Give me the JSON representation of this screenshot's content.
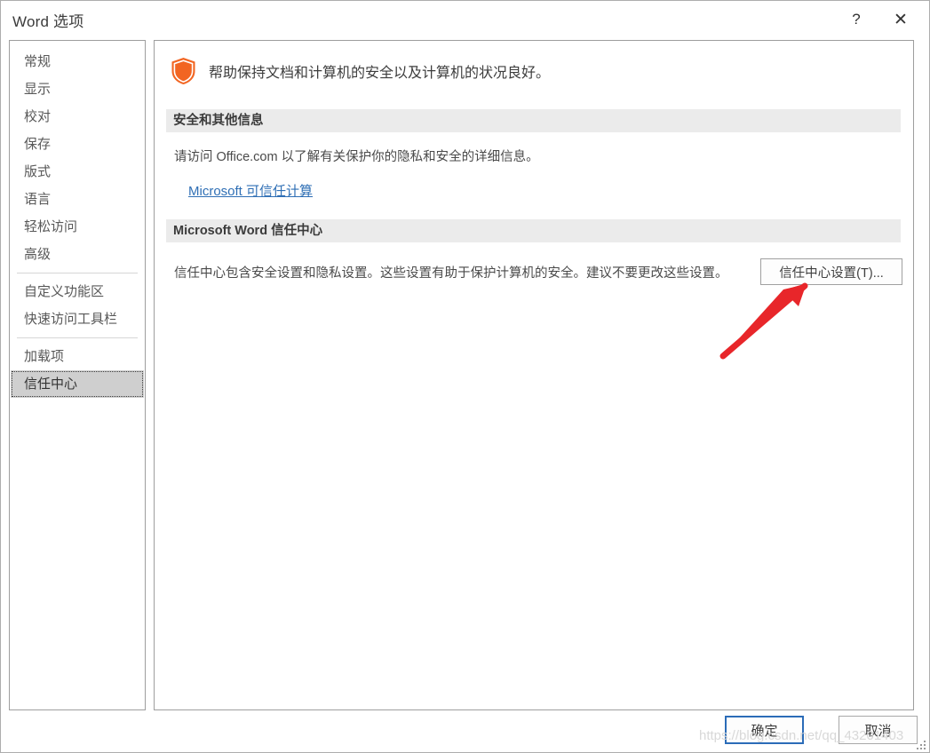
{
  "window": {
    "title": "Word 选项",
    "help_icon": "?",
    "close_icon": "✕"
  },
  "sidebar": {
    "items": [
      {
        "label": "常规",
        "selected": false
      },
      {
        "label": "显示",
        "selected": false
      },
      {
        "label": "校对",
        "selected": false
      },
      {
        "label": "保存",
        "selected": false
      },
      {
        "label": "版式",
        "selected": false
      },
      {
        "label": "语言",
        "selected": false
      },
      {
        "label": "轻松访问",
        "selected": false
      },
      {
        "label": "高级",
        "selected": false
      },
      {
        "separator": true
      },
      {
        "label": "自定义功能区",
        "selected": false
      },
      {
        "label": "快速访问工具栏",
        "selected": false
      },
      {
        "separator": true
      },
      {
        "label": "加载项",
        "selected": false
      },
      {
        "label": "信任中心",
        "selected": true
      }
    ]
  },
  "main": {
    "heading": "帮助保持文档和计算机的安全以及计算机的状况良好。",
    "security_section": {
      "banner": "安全和其他信息",
      "description": "请访问 Office.com 以了解有关保护你的隐私和安全的详细信息。",
      "link": "Microsoft 可信任计算"
    },
    "trust_section": {
      "banner": "Microsoft Word 信任中心",
      "description": "信任中心包含安全设置和隐私设置。这些设置有助于保护计算机的安全。建议不要更改这些设置。",
      "settings_button": "信任中心设置(T)..."
    }
  },
  "footer": {
    "ok_label": "确定",
    "cancel_label": "取消"
  },
  "watermark": "https://blog.csdn.net/qq_43201403",
  "colors": {
    "shield": "#f26522",
    "link": "#2f6fb5",
    "focus_border": "#2b6cb8",
    "banner_bg": "#ebebeb",
    "selected_bg": "#cfcfcf",
    "annotation": "#e8262a"
  }
}
